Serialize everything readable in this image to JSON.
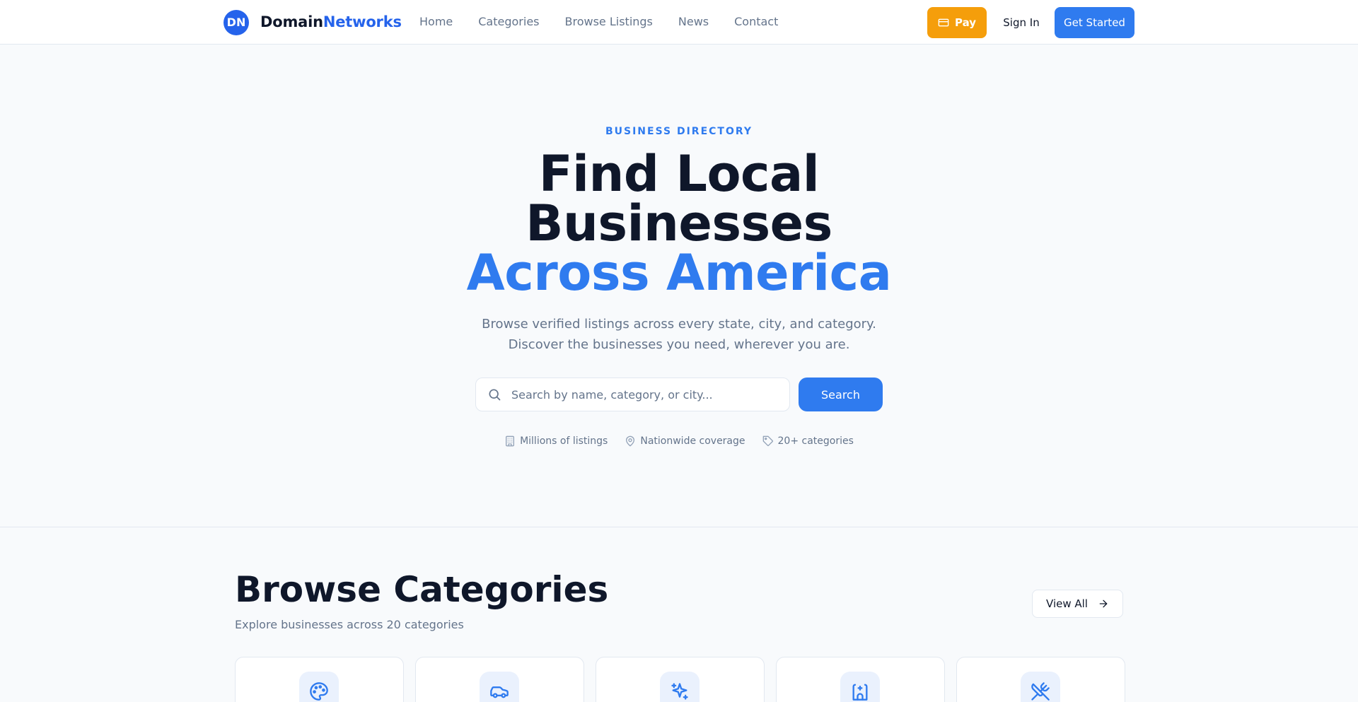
{
  "header": {
    "logo_initials": "DN",
    "logo_name_part1": "Domain",
    "logo_name_part2": "Networks",
    "nav": [
      "Home",
      "Categories",
      "Browse Listings",
      "News",
      "Contact"
    ],
    "pay_label": "Pay",
    "signin_label": "Sign In",
    "get_started_label": "Get Started"
  },
  "hero": {
    "eyebrow": "BUSINESS DIRECTORY",
    "title_line1": "Find Local",
    "title_line2": "Businesses",
    "title_line3": "Across America",
    "subtitle_line1": "Browse verified listings across every state, city, and category.",
    "subtitle_line2": "Discover the businesses you need, wherever you are.",
    "search_placeholder": "Search by name, category, or city...",
    "search_value": "",
    "search_button": "Search",
    "features": [
      {
        "icon": "building-icon",
        "label": "Millions of listings"
      },
      {
        "icon": "map-pin-icon",
        "label": "Nationwide coverage"
      },
      {
        "icon": "tag-icon",
        "label": "20+ categories"
      }
    ]
  },
  "categories": {
    "title": "Browse Categories",
    "subtitle": "Explore businesses across 20 categories",
    "view_all_label": "View All",
    "cards": [
      {
        "icon": "palette-icon"
      },
      {
        "icon": "car-icon"
      },
      {
        "icon": "sparkles-icon"
      },
      {
        "icon": "hospital-icon"
      },
      {
        "icon": "utensils-crossed-icon"
      }
    ]
  },
  "colors": {
    "accent": "#2f7bef",
    "pay": "#f59e0b",
    "text": "#0f172a",
    "muted": "#64748b"
  }
}
